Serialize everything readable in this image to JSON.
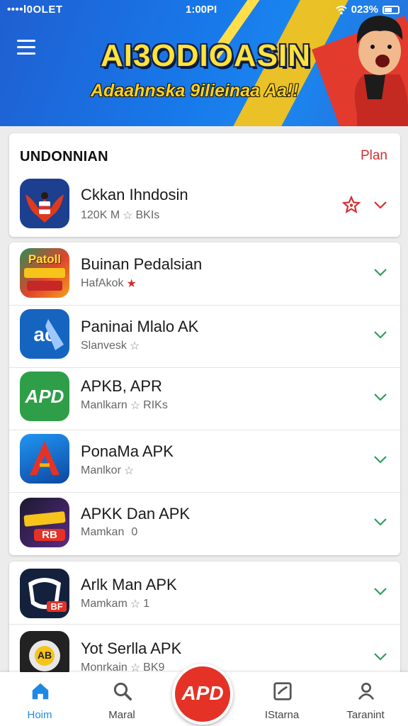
{
  "status_bar": {
    "carrier": "••••l0OLET",
    "time": "1:00PI",
    "battery": "023%"
  },
  "banner": {
    "title": "AI3ODIOASIN",
    "subtitle": "Adaahnska 9ilieinaa Aa!!"
  },
  "section1": {
    "title": "UNDONNIAN",
    "action": "Plan",
    "items": [
      {
        "name": "Ckkan Ihndosin",
        "meta": "120K M",
        "meta2": "BKIs",
        "star": "gray"
      }
    ]
  },
  "section2": {
    "items": [
      {
        "name": "Buinan Pedalsian",
        "meta": "HafAkok",
        "meta2": "",
        "star": "red",
        "icon_text": "Patoll"
      },
      {
        "name": "Paninai Mlalo AK",
        "meta": "Slanvesk",
        "meta2": "",
        "star": "gray",
        "icon_text": "ac"
      },
      {
        "name": "APKB, APR",
        "meta": "Manlkarn",
        "meta2": "RIKs",
        "star": "gray",
        "icon_text": "APD"
      },
      {
        "name": "PonaMa APK",
        "meta": "Manlkor",
        "meta2": "",
        "star": "gray",
        "icon_text": "A"
      },
      {
        "name": "APKK Dan APK",
        "meta": "Mamkan",
        "meta2": "0",
        "star": "none",
        "icon_text": "RB"
      }
    ]
  },
  "section3": {
    "items": [
      {
        "name": "Arlk Man APK",
        "meta": "Mamkam",
        "meta2": "1",
        "star": "gray",
        "icon_text": "BF"
      },
      {
        "name": "Yot Serlla APK",
        "meta": "Monrkain",
        "meta2": "BK9",
        "star": "gray",
        "icon_text": "AB"
      }
    ]
  },
  "bottom_nav": {
    "items": [
      {
        "label": "Hoim",
        "icon": "home-icon"
      },
      {
        "label": "Maral",
        "icon": "search-icon"
      },
      {
        "label": "IStarna",
        "icon": "store-icon"
      },
      {
        "label": "Taranint",
        "icon": "profile-icon"
      }
    ],
    "fab_text": "APD"
  },
  "colors": {
    "accent_blue": "#1e88e5",
    "accent_red": "#e53227",
    "chevron_green": "#2e9e5b",
    "banner_yellow": "#ffe33a"
  }
}
